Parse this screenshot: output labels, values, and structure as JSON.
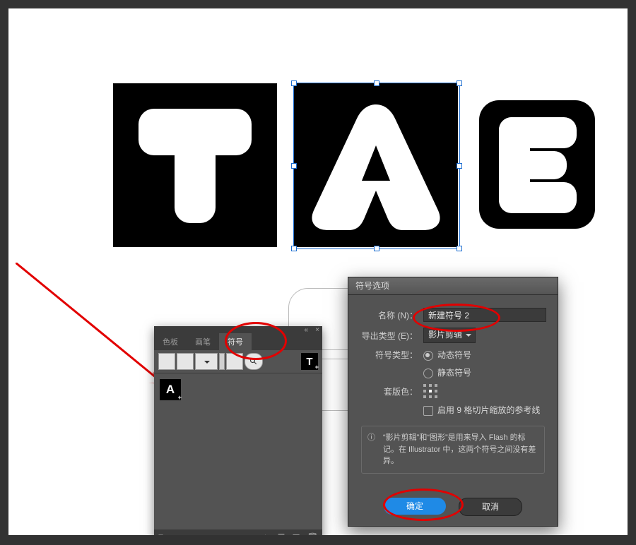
{
  "canvas": {
    "letters": {
      "t": "T",
      "a": "A",
      "e": "E"
    }
  },
  "panel": {
    "tabs": {
      "swatches": "色板",
      "brushes": "画笔",
      "symbols": "符号"
    },
    "thumb_T": "T",
    "thumb_A": "A"
  },
  "dialog": {
    "title": "符号选项",
    "name_label": "名称 (N)：",
    "name_value": "新建符号 2",
    "export_label": "导出类型 (E)：",
    "export_value": "影片剪辑",
    "symtype_label": "符号类型：",
    "symtype_dynamic": "动态符号",
    "symtype_static": "静态符号",
    "reg_label": "套版色：",
    "nine_slice": "启用 9 格切片缩放的参考线",
    "note": "“影片剪辑”和“图形”是用来导入 Flash 的标记。在 Illustrator 中，这两个符号之间没有差异。",
    "ok": "确定",
    "cancel": "取消"
  }
}
